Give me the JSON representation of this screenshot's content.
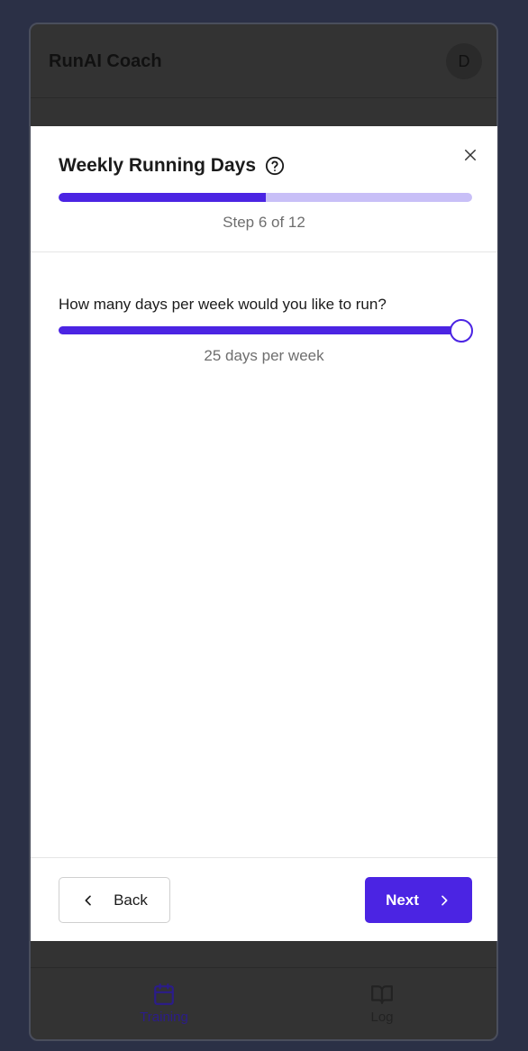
{
  "app": {
    "title": "RunAI Coach",
    "avatar_initial": "D"
  },
  "bottom_nav": {
    "items": [
      {
        "label": "Training",
        "icon": "calendar-icon",
        "active": true
      },
      {
        "label": "Log",
        "icon": "book-icon",
        "active": false
      }
    ]
  },
  "modal": {
    "title": "Weekly Running Days",
    "help_icon": "help-circle-icon",
    "close_icon": "close-icon",
    "progress": {
      "current_step": 6,
      "total_steps": 12,
      "fraction": 0.5
    },
    "step_text": "Step 6 of 12",
    "question": "How many days per week would you like to run?",
    "slider": {
      "value": 25,
      "fraction": 1.0
    },
    "slider_value_text": "25 days per week",
    "back_label": "Back",
    "next_label": "Next"
  },
  "colors": {
    "accent": "#4b24e3",
    "accent_light": "#c8bff7",
    "background": "#2b3046"
  }
}
